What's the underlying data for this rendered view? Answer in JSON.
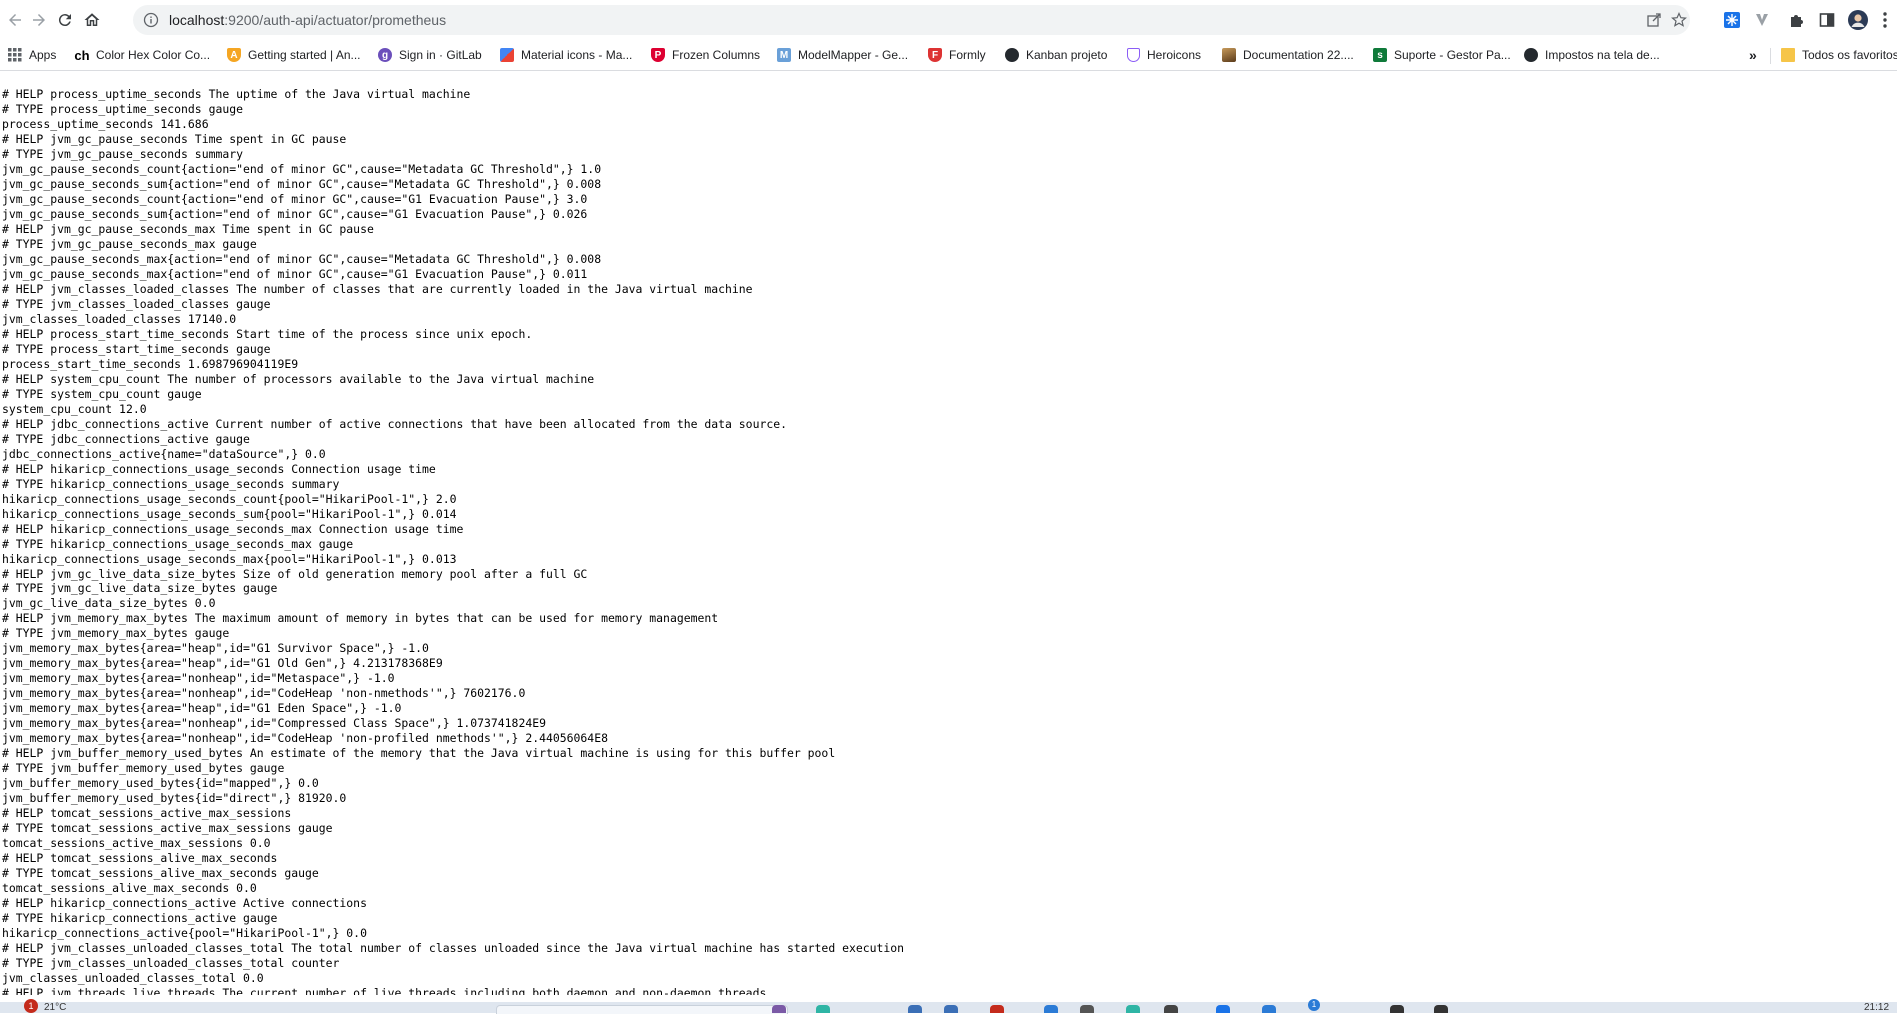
{
  "browser": {
    "url_host": "localhost",
    "url_path": ":9200/auth-api/actuator/prometheus"
  },
  "bookmarks": {
    "items": [
      {
        "label": "Apps",
        "icon": "apps-grid-icon",
        "color": "#5f6368"
      },
      {
        "label": "Color Hex Color Co...",
        "icon": "colorhex-icon",
        "color": "#000000"
      },
      {
        "label": "Getting started | An...",
        "icon": "angular-shield-icon",
        "color": "#f5a623"
      },
      {
        "label": "Sign in · GitLab",
        "icon": "gitlab-icon",
        "color": "#6b4fbb"
      },
      {
        "label": "Material icons - Ma...",
        "icon": "material-icon",
        "color": "#4285f4"
      },
      {
        "label": "Frozen Columns",
        "icon": "primeng-shield-icon",
        "color": "#dd0031"
      },
      {
        "label": "ModelMapper - Ge...",
        "icon": "modelmapper-icon",
        "color": "#6aa0d8"
      },
      {
        "label": "Formly",
        "icon": "formly-shield-icon",
        "color": "#dd3333"
      },
      {
        "label": "Kanban projeto",
        "icon": "github-icon",
        "color": "#24292e"
      },
      {
        "label": "Heroicons",
        "icon": "heroicons-shield-icon",
        "color": "#8b5cf6"
      },
      {
        "label": "Documentation 22....",
        "icon": "documentation-icon",
        "color": "#8b5a2b"
      },
      {
        "label": "Suporte - Gestor Pa...",
        "icon": "suporte-icon",
        "color": "#0f7a3a"
      },
      {
        "label": "Impostos na tela de...",
        "icon": "github-icon",
        "color": "#24292e"
      }
    ],
    "overflow_label": "»",
    "other_folder_label": "Todos os favoritos"
  },
  "content": {
    "lines": [
      "# HELP process_uptime_seconds The uptime of the Java virtual machine",
      "# TYPE process_uptime_seconds gauge",
      "process_uptime_seconds 141.686",
      "# HELP jvm_gc_pause_seconds Time spent in GC pause",
      "# TYPE jvm_gc_pause_seconds summary",
      "jvm_gc_pause_seconds_count{action=\"end of minor GC\",cause=\"Metadata GC Threshold\",} 1.0",
      "jvm_gc_pause_seconds_sum{action=\"end of minor GC\",cause=\"Metadata GC Threshold\",} 0.008",
      "jvm_gc_pause_seconds_count{action=\"end of minor GC\",cause=\"G1 Evacuation Pause\",} 3.0",
      "jvm_gc_pause_seconds_sum{action=\"end of minor GC\",cause=\"G1 Evacuation Pause\",} 0.026",
      "# HELP jvm_gc_pause_seconds_max Time spent in GC pause",
      "# TYPE jvm_gc_pause_seconds_max gauge",
      "jvm_gc_pause_seconds_max{action=\"end of minor GC\",cause=\"Metadata GC Threshold\",} 0.008",
      "jvm_gc_pause_seconds_max{action=\"end of minor GC\",cause=\"G1 Evacuation Pause\",} 0.011",
      "# HELP jvm_classes_loaded_classes The number of classes that are currently loaded in the Java virtual machine",
      "# TYPE jvm_classes_loaded_classes gauge",
      "jvm_classes_loaded_classes 17140.0",
      "# HELP process_start_time_seconds Start time of the process since unix epoch.",
      "# TYPE process_start_time_seconds gauge",
      "process_start_time_seconds 1.698796904119E9",
      "# HELP system_cpu_count The number of processors available to the Java virtual machine",
      "# TYPE system_cpu_count gauge",
      "system_cpu_count 12.0",
      "# HELP jdbc_connections_active Current number of active connections that have been allocated from the data source.",
      "# TYPE jdbc_connections_active gauge",
      "jdbc_connections_active{name=\"dataSource\",} 0.0",
      "# HELP hikaricp_connections_usage_seconds Connection usage time",
      "# TYPE hikaricp_connections_usage_seconds summary",
      "hikaricp_connections_usage_seconds_count{pool=\"HikariPool-1\",} 2.0",
      "hikaricp_connections_usage_seconds_sum{pool=\"HikariPool-1\",} 0.014",
      "# HELP hikaricp_connections_usage_seconds_max Connection usage time",
      "# TYPE hikaricp_connections_usage_seconds_max gauge",
      "hikaricp_connections_usage_seconds_max{pool=\"HikariPool-1\",} 0.013",
      "# HELP jvm_gc_live_data_size_bytes Size of old generation memory pool after a full GC",
      "# TYPE jvm_gc_live_data_size_bytes gauge",
      "jvm_gc_live_data_size_bytes 0.0",
      "# HELP jvm_memory_max_bytes The maximum amount of memory in bytes that can be used for memory management",
      "# TYPE jvm_memory_max_bytes gauge",
      "jvm_memory_max_bytes{area=\"heap\",id=\"G1 Survivor Space\",} -1.0",
      "jvm_memory_max_bytes{area=\"heap\",id=\"G1 Old Gen\",} 4.213178368E9",
      "jvm_memory_max_bytes{area=\"nonheap\",id=\"Metaspace\",} -1.0",
      "jvm_memory_max_bytes{area=\"nonheap\",id=\"CodeHeap 'non-nmethods'\",} 7602176.0",
      "jvm_memory_max_bytes{area=\"heap\",id=\"G1 Eden Space\",} -1.0",
      "jvm_memory_max_bytes{area=\"nonheap\",id=\"Compressed Class Space\",} 1.073741824E9",
      "jvm_memory_max_bytes{area=\"nonheap\",id=\"CodeHeap 'non-profiled nmethods'\",} 2.44056064E8",
      "# HELP jvm_buffer_memory_used_bytes An estimate of the memory that the Java virtual machine is using for this buffer pool",
      "# TYPE jvm_buffer_memory_used_bytes gauge",
      "jvm_buffer_memory_used_bytes{id=\"mapped\",} 0.0",
      "jvm_buffer_memory_used_bytes{id=\"direct\",} 81920.0",
      "# HELP tomcat_sessions_active_max_sessions",
      "# TYPE tomcat_sessions_active_max_sessions gauge",
      "tomcat_sessions_active_max_sessions 0.0",
      "# HELP tomcat_sessions_alive_max_seconds",
      "# TYPE tomcat_sessions_alive_max_seconds gauge",
      "tomcat_sessions_alive_max_seconds 0.0",
      "# HELP hikaricp_connections_active Active connections",
      "# TYPE hikaricp_connections_active gauge",
      "hikaricp_connections_active{pool=\"HikariPool-1\",} 0.0",
      "# HELP jvm_classes_unloaded_classes_total The total number of classes unloaded since the Java virtual machine has started execution",
      "# TYPE jvm_classes_unloaded_classes_total counter",
      "jvm_classes_unloaded_classes_total 0.0",
      "# HELP jvm_threads_live_threads The current number of live threads including both daemon and non-daemon threads"
    ]
  },
  "taskbar": {
    "weather_badge": "1",
    "weather_temp": "21°C",
    "notification_badge": "1",
    "clock": "21:12"
  }
}
